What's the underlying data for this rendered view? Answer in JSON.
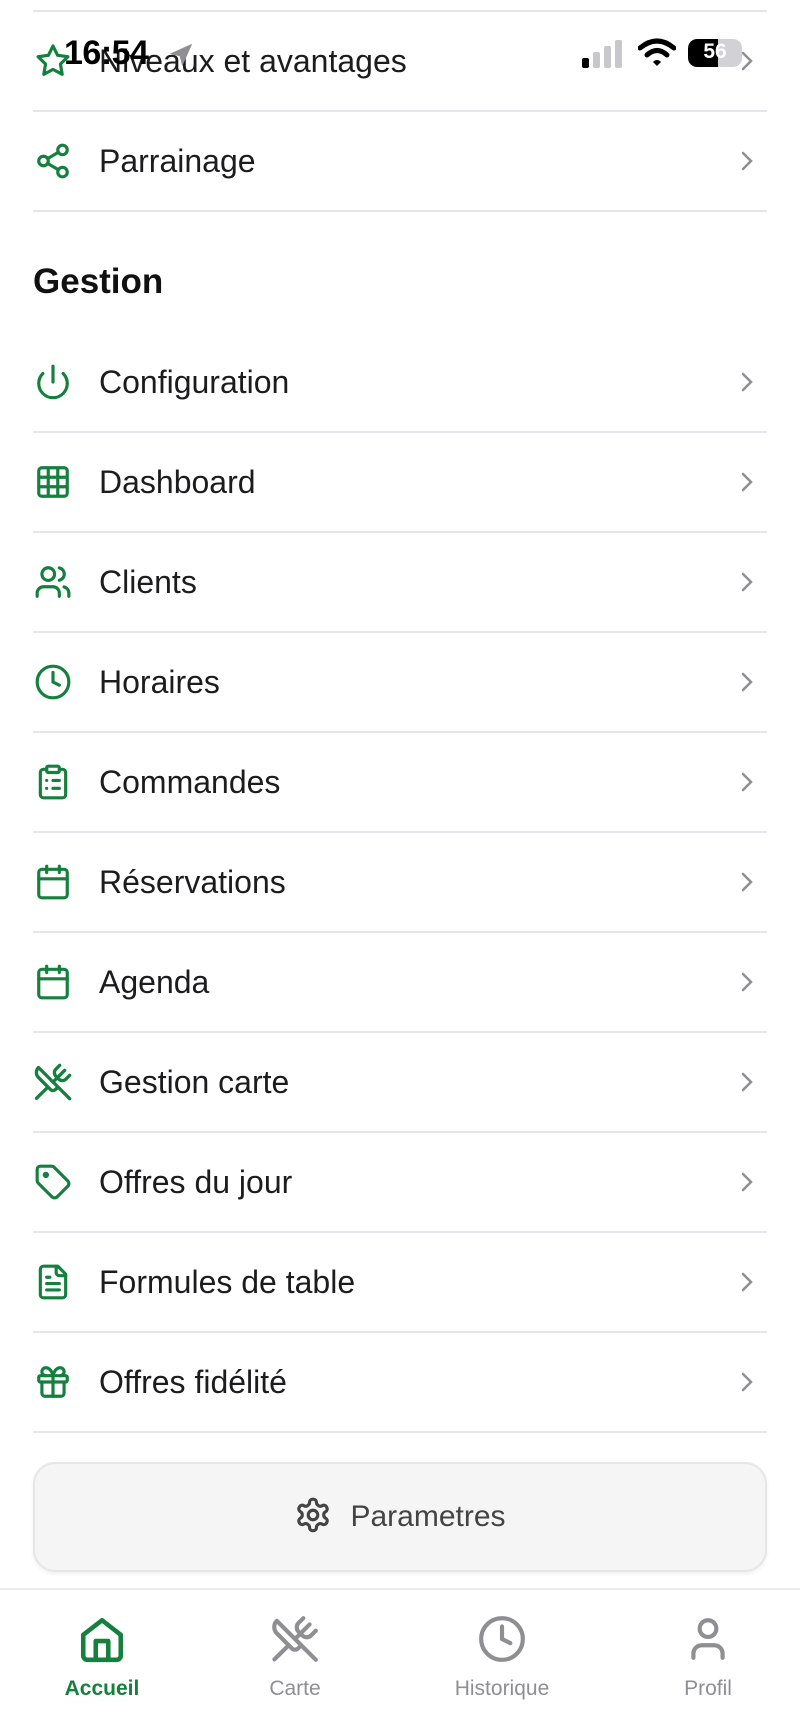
{
  "status_bar": {
    "time": "16:54",
    "battery": "56",
    "battery_level": 0.56
  },
  "menu_top": [
    {
      "label": "Niveaux et avantages",
      "icon": "star-icon"
    },
    {
      "label": "Parrainage",
      "icon": "share-icon"
    }
  ],
  "section": {
    "title": "Gestion"
  },
  "menu_gestion": [
    {
      "label": "Configuration",
      "icon": "power-icon"
    },
    {
      "label": "Dashboard",
      "icon": "grid-icon"
    },
    {
      "label": "Clients",
      "icon": "users-icon"
    },
    {
      "label": "Horaires",
      "icon": "clock-icon"
    },
    {
      "label": "Commandes",
      "icon": "clipboard-list-icon"
    },
    {
      "label": "Réservations",
      "icon": "calendar-icon"
    },
    {
      "label": "Agenda",
      "icon": "calendar-icon"
    },
    {
      "label": "Gestion carte",
      "icon": "utensils-crossed-icon"
    },
    {
      "label": "Offres du jour",
      "icon": "tag-icon"
    },
    {
      "label": "Formules de table",
      "icon": "file-text-icon"
    },
    {
      "label": "Offres fidélité",
      "icon": "gift-icon"
    }
  ],
  "settings_button": {
    "label": "Parametres",
    "icon": "gear-icon"
  },
  "tab_bar": [
    {
      "label": "Accueil",
      "icon": "home-icon",
      "active": true
    },
    {
      "label": "Carte",
      "icon": "utensils-crossed-icon",
      "active": false
    },
    {
      "label": "Historique",
      "icon": "clock-icon",
      "active": false
    },
    {
      "label": "Profil",
      "icon": "user-icon",
      "active": false
    }
  ],
  "colors": {
    "accent": "#15803d",
    "chevron": "#8e8e93",
    "divider": "#e5e5ea",
    "tab_inactive": "#8e8e93"
  }
}
